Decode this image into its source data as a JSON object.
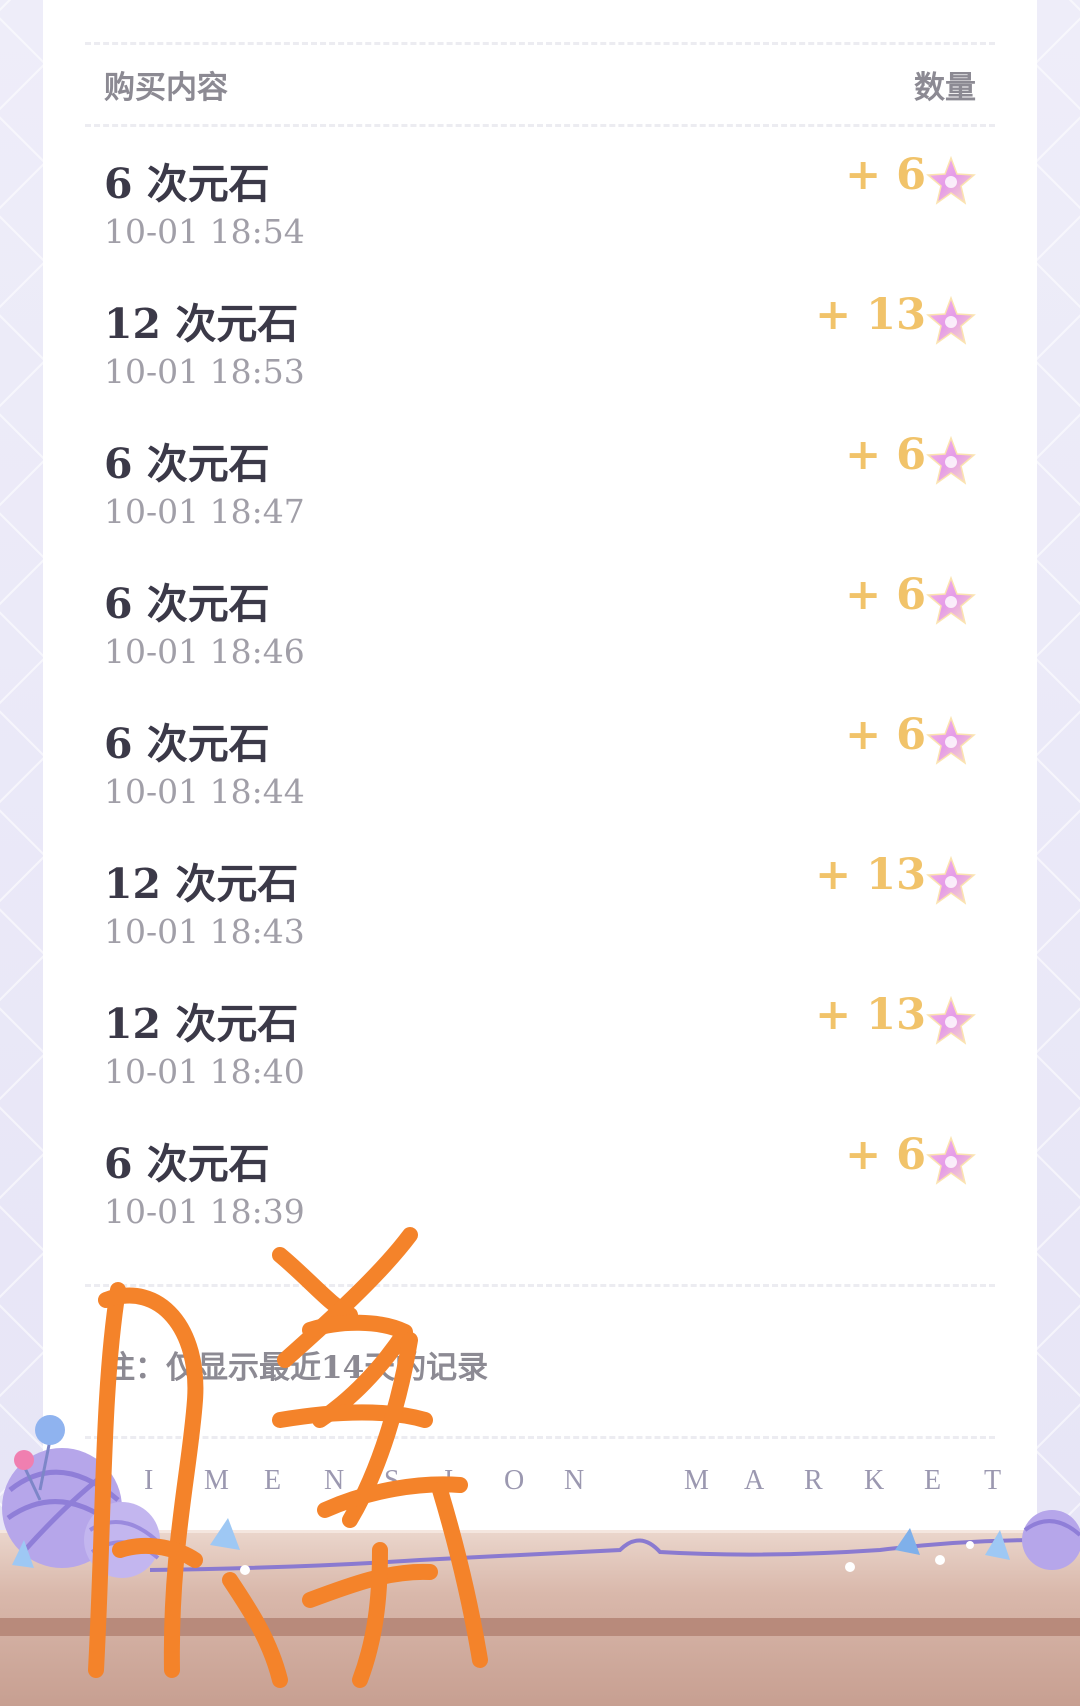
{
  "header": {
    "content_label": "购买内容",
    "quantity_label": "数量"
  },
  "colors": {
    "amount_gold": "#f1c36a",
    "title_dark": "#3b3948",
    "time_gray": "#a19fa8",
    "scribble_orange": "#f4832a"
  },
  "records": [
    {
      "title": "6 次元石",
      "time": "10-01 18:54",
      "amount": "+ 6",
      "icon": "star-gem-icon"
    },
    {
      "title": "12 次元石",
      "time": "10-01 18:53",
      "amount": "+ 13",
      "icon": "star-gem-icon"
    },
    {
      "title": "6 次元石",
      "time": "10-01 18:47",
      "amount": "+ 6",
      "icon": "star-gem-icon"
    },
    {
      "title": "6 次元石",
      "time": "10-01 18:46",
      "amount": "+ 6",
      "icon": "star-gem-icon"
    },
    {
      "title": "6 次元石",
      "time": "10-01 18:44",
      "amount": "+ 6",
      "icon": "star-gem-icon"
    },
    {
      "title": "12 次元石",
      "time": "10-01 18:43",
      "amount": "+ 13",
      "icon": "star-gem-icon"
    },
    {
      "title": "12 次元石",
      "time": "10-01 18:40",
      "amount": "+ 13",
      "icon": "star-gem-icon"
    },
    {
      "title": "6 次元石",
      "time": "10-01 18:39",
      "amount": "+ 6",
      "icon": "star-gem-icon"
    }
  ],
  "footer": {
    "note_visible": "注：仅显示最近14天的记录",
    "brand": "DIMENSION MARKET"
  }
}
